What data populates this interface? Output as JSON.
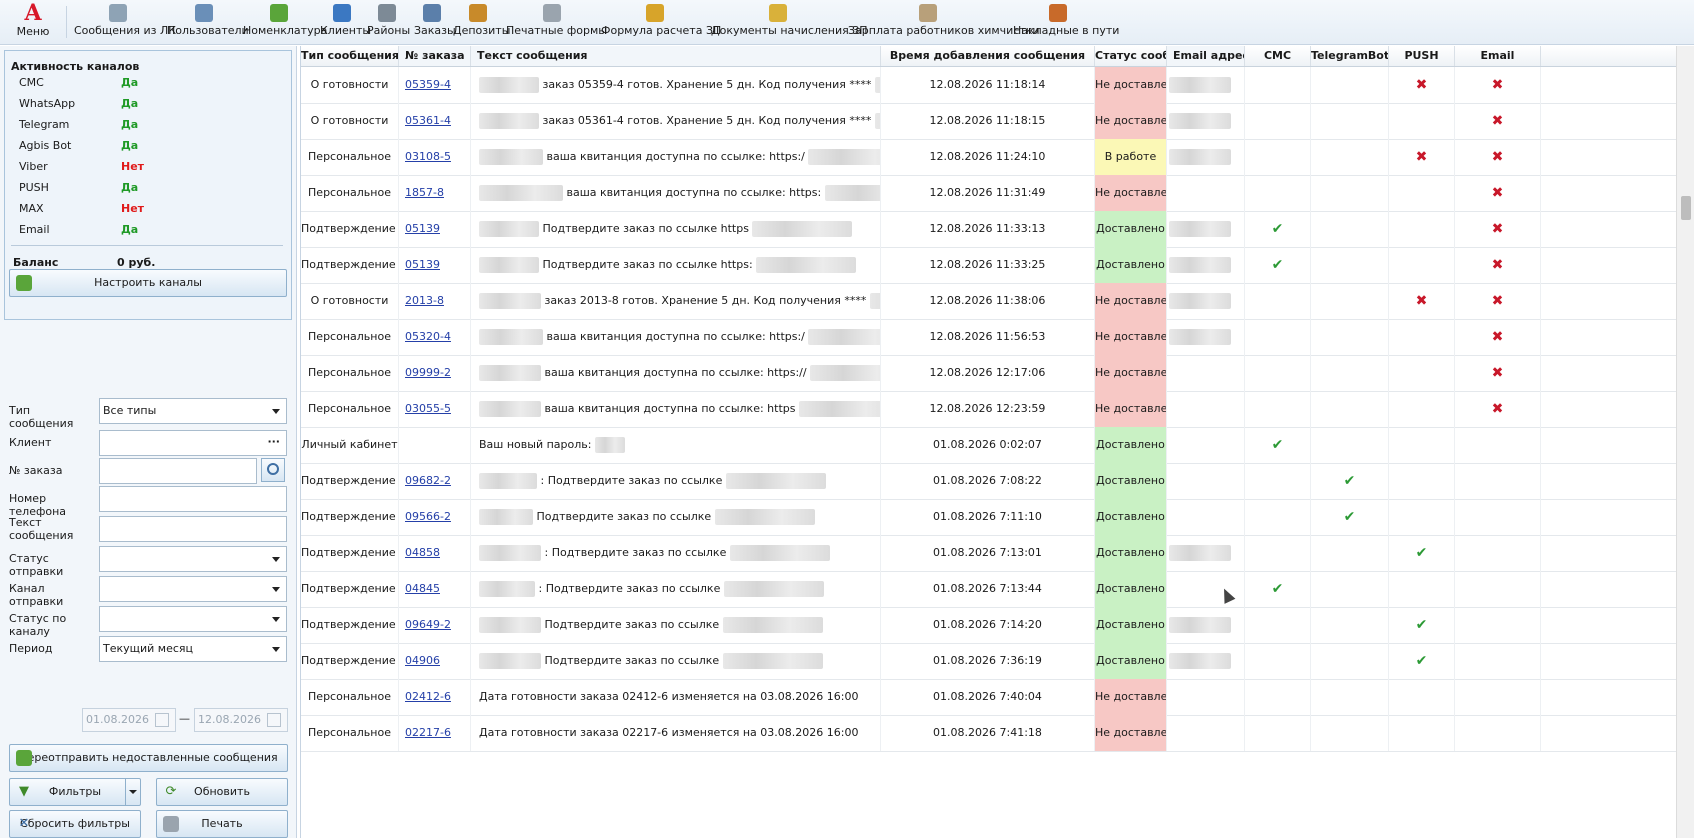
{
  "toolbar": {
    "menu": {
      "logo": "A",
      "label": "Меню"
    },
    "items": [
      {
        "label": "Сообщения из ЛК",
        "icon": "monitor-icon",
        "color": "#8ea3b5"
      },
      {
        "label": "Пользователи",
        "icon": "users-icon",
        "color": "#6a8fb8"
      },
      {
        "label": "Номенклатура",
        "icon": "basket-icon",
        "color": "#5aa53a"
      },
      {
        "label": "Клиенты",
        "icon": "client-icon",
        "color": "#3b78c2"
      },
      {
        "label": "Районы",
        "icon": "districts-icon",
        "color": "#7d8a96"
      },
      {
        "label": "Заказы",
        "icon": "orders-icon",
        "color": "#5b7faa"
      },
      {
        "label": "Депозиты",
        "icon": "deposit-icon",
        "color": "#c88a2a"
      },
      {
        "label": "Печатные формы",
        "icon": "printer-icon",
        "color": "#9aa4ae"
      },
      {
        "label": "Формула расчета ЗП",
        "icon": "formula-icon",
        "color": "#d7a42a"
      },
      {
        "label": "Документы начисления ЗП",
        "icon": "documents-icon",
        "color": "#d9b13a"
      },
      {
        "label": "Зарплата работников химчистки",
        "icon": "salary-icon",
        "color": "#b8a07a"
      },
      {
        "label": "Накладные в пути",
        "icon": "truck-icon",
        "color": "#c86a2a"
      }
    ]
  },
  "channels": {
    "title": "Активность каналов",
    "rows": [
      {
        "name": "СМС",
        "value": "Да"
      },
      {
        "name": "WhatsApp",
        "value": "Да"
      },
      {
        "name": "Telegram",
        "value": "Да"
      },
      {
        "name": "Agbis Bot",
        "value": "Да"
      },
      {
        "name": "Viber",
        "value": "Нет"
      },
      {
        "name": "PUSH",
        "value": "Да"
      },
      {
        "name": "MAX",
        "value": "Нет"
      },
      {
        "name": "Email",
        "value": "Да"
      }
    ],
    "balance_label": "Баланс",
    "balance_value": "0 руб.",
    "configure_button": "Настроить каналы"
  },
  "filters": {
    "type_label": "Тип сообщения",
    "type_value": "Все типы",
    "client_label": "Клиент",
    "client_value": "",
    "order_label": "№ заказа",
    "order_value": "",
    "phone_label": "Номер телефона",
    "phone_value": "",
    "text_label": "Текст сообщения",
    "text_value": "",
    "send_status_label": "Статус отправки",
    "send_status_value": "",
    "send_channel_label": "Канал отправки",
    "send_channel_value": "",
    "channel_status_label": "Статус по каналу",
    "channel_status_value": "",
    "period_label": "Период",
    "period_value": "Текущий месяц",
    "date_from": "01.08.2026",
    "date_dash": "—",
    "date_to": "12.08.2026"
  },
  "buttons": {
    "resend": "Переотправить недоставленные сообщения",
    "filters": "Фильтры",
    "refresh": "Обновить",
    "reset": "Сбросить фильтры",
    "print": "Печать"
  },
  "grid": {
    "columns": [
      "Тип сообщения",
      "№ заказа",
      "Текст сообщения",
      "Время добавления сообщения",
      "Статус сооб...",
      "Email адрес",
      "СМС",
      "TelegramBot",
      "PUSH",
      "Email"
    ],
    "rows": [
      {
        "type": "О готовности",
        "order": "05359-4",
        "text": "заказ 05359-4 готов. Хранение 5 дн. Код получения ****",
        "time": "12.08.2026 11:18:14",
        "status": "Не доставлено",
        "st": "red",
        "email": true,
        "sms": "",
        "tg": "",
        "push": "x",
        "em": "x"
      },
      {
        "type": "О готовности",
        "order": "05361-4",
        "text": "заказ 05361-4 готов. Хранение 5 дн. Код получения ****",
        "time": "12.08.2026 11:18:15",
        "status": "Не доставлено",
        "st": "red",
        "email": true,
        "sms": "",
        "tg": "",
        "push": "",
        "em": "x"
      },
      {
        "type": "Персональное",
        "order": "03108-5",
        "text": "ваша квитанция доступна по ссылке: https:/",
        "time": "12.08.2026 11:24:10",
        "status": "В работе",
        "st": "yellow",
        "email": true,
        "sms": "",
        "tg": "",
        "push": "x",
        "em": "x"
      },
      {
        "type": "Персональное",
        "order": "1857-8",
        "text": "ваша квитанция доступна по ссылке: https:",
        "time": "12.08.2026 11:31:49",
        "status": "Не доставлено",
        "st": "red",
        "email": false,
        "sms": "",
        "tg": "",
        "push": "",
        "em": "x"
      },
      {
        "type": "Подтверждение заказа",
        "order": "05139",
        "text": "Подтвердите заказ по ссылке https",
        "time": "12.08.2026 11:33:13",
        "status": "Доставлено",
        "st": "green",
        "email": true,
        "sms": "ok",
        "tg": "",
        "push": "",
        "em": "x"
      },
      {
        "type": "Подтверждение заказа",
        "order": "05139",
        "text": "Подтвердите заказ по ссылке https:",
        "time": "12.08.2026 11:33:25",
        "status": "Доставлено",
        "st": "green",
        "email": true,
        "sms": "ok",
        "tg": "",
        "push": "",
        "em": "x"
      },
      {
        "type": "О готовности",
        "order": "2013-8",
        "text": "заказ 2013-8 готов. Хранение 5 дн. Код получения ****",
        "time": "12.08.2026 11:38:06",
        "status": "Не доставлено",
        "st": "red",
        "email": true,
        "sms": "",
        "tg": "",
        "push": "x",
        "em": "x"
      },
      {
        "type": "Персональное",
        "order": "05320-4",
        "text": "ваша квитанция доступна по ссылке: https:/",
        "time": "12.08.2026 11:56:53",
        "status": "Не доставлено",
        "st": "red",
        "email": true,
        "sms": "",
        "tg": "",
        "push": "",
        "em": "x"
      },
      {
        "type": "Персональное",
        "order": "09999-2",
        "text": "ваша квитанция доступна по ссылке: https://",
        "time": "12.08.2026 12:17:06",
        "status": "Не доставлено",
        "st": "red",
        "email": false,
        "sms": "",
        "tg": "",
        "push": "",
        "em": "x"
      },
      {
        "type": "Персональное",
        "order": "03055-5",
        "text": "ваша квитанция доступна по ссылке: https",
        "time": "12.08.2026 12:23:59",
        "status": "Не доставлено",
        "st": "red",
        "email": false,
        "sms": "",
        "tg": "",
        "push": "",
        "em": "x"
      },
      {
        "type": "Личный кабинет",
        "order": "",
        "text": "Ваш новый пароль:",
        "time": "01.08.2026 0:02:07",
        "status": "Доставлено",
        "st": "green",
        "email": false,
        "sms": "ok",
        "tg": "",
        "push": "",
        "em": ""
      },
      {
        "type": "Подтверждение заказа",
        "order": "09682-2",
        "text": ": Подтвердите заказ по ссылке",
        "time": "01.08.2026 7:08:22",
        "status": "Доставлено",
        "st": "green",
        "email": false,
        "sms": "",
        "tg": "ok",
        "push": "",
        "em": ""
      },
      {
        "type": "Подтверждение заказа",
        "order": "09566-2",
        "text": "Подтвердите заказ по ссылке",
        "time": "01.08.2026 7:11:10",
        "status": "Доставлено",
        "st": "green",
        "email": false,
        "sms": "",
        "tg": "ok",
        "push": "",
        "em": ""
      },
      {
        "type": "Подтверждение заказа",
        "order": "04858",
        "text": ": Подтвердите заказ по ссылке",
        "time": "01.08.2026 7:13:01",
        "status": "Доставлено",
        "st": "green",
        "email": true,
        "sms": "",
        "tg": "",
        "push": "ok",
        "em": ""
      },
      {
        "type": "Подтверждение заказа",
        "order": "04845",
        "text": ": Подтвердите заказ по ссылке",
        "time": "01.08.2026 7:13:44",
        "status": "Доставлено",
        "st": "green",
        "email": false,
        "sms": "ok",
        "tg": "",
        "push": "",
        "em": ""
      },
      {
        "type": "Подтверждение заказа",
        "order": "09649-2",
        "text": "Подтвердите заказ по ссылке",
        "time": "01.08.2026 7:14:20",
        "status": "Доставлено",
        "st": "green",
        "email": true,
        "sms": "",
        "tg": "",
        "push": "ok",
        "em": ""
      },
      {
        "type": "Подтверждение заказа",
        "order": "04906",
        "text": "Подтвердите заказ по ссылке",
        "time": "01.08.2026 7:36:19",
        "status": "Доставлено",
        "st": "green",
        "email": true,
        "sms": "",
        "tg": "",
        "push": "ok",
        "em": ""
      },
      {
        "type": "Персональное",
        "order": "02412-6",
        "text": "Дата готовности заказа 02412-6 изменяется на 03.08.2026 16:00",
        "time": "01.08.2026 7:40:04",
        "status": "Не доставлено",
        "st": "red",
        "email": false,
        "sms": "",
        "tg": "",
        "push": "",
        "em": ""
      },
      {
        "type": "Персональное",
        "order": "02217-6",
        "text": "Дата готовности заказа 02217-6 изменяется на 03.08.2026 16:00",
        "time": "01.08.2026 7:41:18",
        "status": "Не доставлено",
        "st": "red",
        "email": false,
        "sms": "",
        "tg": "",
        "push": "",
        "em": ""
      }
    ]
  }
}
